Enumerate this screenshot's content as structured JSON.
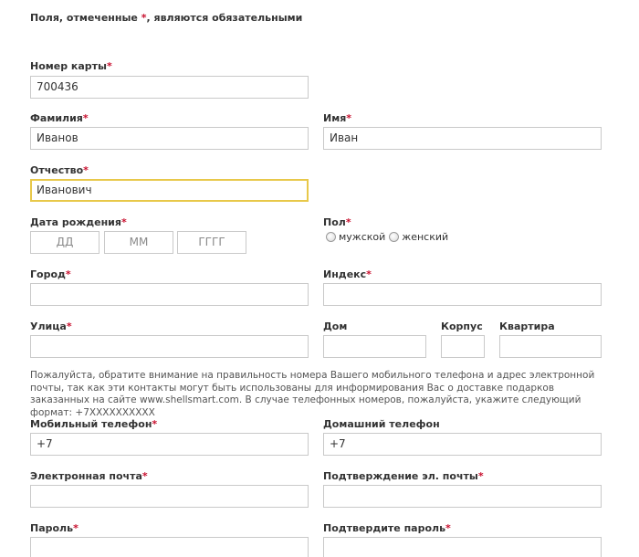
{
  "colors": {
    "required_star": "#c8102e",
    "focus_border": "#e8c84a"
  },
  "required_note": {
    "before": "Поля, отмеченные ",
    "star": "*",
    "after": ", являются обязательными"
  },
  "fields": {
    "card_number": {
      "label": "Номер карты",
      "value": "700436"
    },
    "last_name": {
      "label": "Фамилия",
      "value": "Иванов"
    },
    "first_name": {
      "label": "Имя",
      "value": "Иван"
    },
    "patronymic": {
      "label": "Отчество",
      "value": "Иванович"
    },
    "birth_date": {
      "label": "Дата рождения",
      "day_placeholder": "ДД",
      "month_placeholder": "ММ",
      "year_placeholder": "ГГГГ"
    },
    "gender": {
      "label": "Пол",
      "options": [
        "мужской",
        "женский"
      ]
    },
    "city": {
      "label": "Город",
      "value": ""
    },
    "postal_code": {
      "label": "Индекс",
      "value": ""
    },
    "street": {
      "label": "Улица",
      "value": ""
    },
    "house": {
      "label": "Дом",
      "value": ""
    },
    "building": {
      "label": "Корпус",
      "value": ""
    },
    "apartment": {
      "label": "Квартира",
      "value": ""
    },
    "mobile_phone": {
      "label": "Мобильный телефон",
      "value": "+7"
    },
    "home_phone": {
      "label": "Домашний телефон",
      "value": "+7"
    },
    "email": {
      "label": "Электронная почта",
      "value": ""
    },
    "email_confirm": {
      "label": "Подтверждение эл. почты",
      "value": ""
    },
    "password": {
      "label": "Пароль",
      "value": ""
    },
    "password_confirm": {
      "label": "Подтвердите пароль",
      "value": ""
    }
  },
  "info_text": "Пожалуйста, обратите внимание на правильность номера Вашего мобильного телефона и адрес электронной почты, так как эти контакты могут быть использованы для информирования Вас о доставке подарков заказанных на сайте www.shellsmart.com. В случае телефонных номеров, пожалуйста, укажите следующий формат: +7XXXXXXXXXX",
  "required_star": "*"
}
